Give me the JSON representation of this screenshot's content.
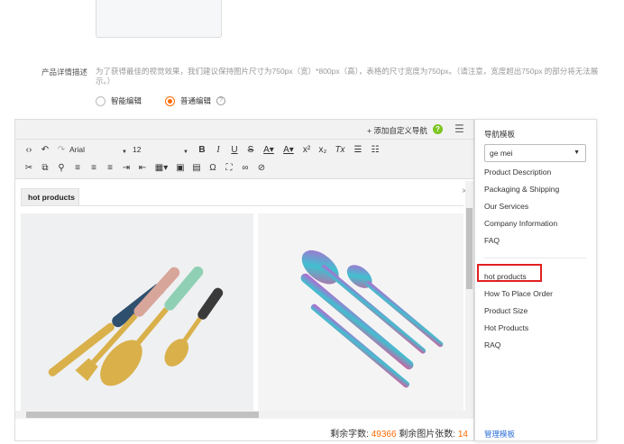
{
  "product_detail": {
    "label": "产品详情描述",
    "hint": "为了获得最佳的视觉效果，我们建议保持图片尺寸为750px（宽）*800px（高），表格的尺寸宽度为750px。（请注意，宽度超出750px 的部分将无法展示。）",
    "mode_smart": "智能编辑",
    "mode_normal": "普通编辑",
    "selected_mode": "普通编辑"
  },
  "editor": {
    "add_nav_label": "+ 添加自定义导航",
    "font_family": "Arial",
    "font_size": "12",
    "tab_label": "hot products",
    "remaining_chars_label": "剩余字数:",
    "remaining_chars_value": "49366",
    "remaining_images_label": "剩余图片张数:",
    "remaining_images_value": "14"
  },
  "sidebar": {
    "title": "导航模板",
    "selected_template": "ge mei",
    "items_top": [
      "Product Description",
      "Packaging & Shipping",
      "Our Services",
      "Company Information",
      "FAQ"
    ],
    "items_bottom": [
      "hot products",
      "How To Place Order",
      "Product Size",
      "Hot Products",
      "RAQ"
    ],
    "highlighted_item": "hot products",
    "manage_label": "管理模板"
  },
  "colors": {
    "accent": "#ff6a00",
    "highlight_border": "#e02020",
    "link": "#2b6fd6",
    "help_green": "#7cc520"
  },
  "icons": {
    "toolbar": [
      "code-icon",
      "undo-icon",
      "redo-icon",
      "bold-icon",
      "italic-icon",
      "underline-icon",
      "strikethrough-icon",
      "font-color-icon",
      "bg-color-icon",
      "superscript-icon",
      "subscript-icon",
      "clear-format-icon",
      "unordered-list-icon",
      "ordered-list-icon",
      "cut-icon",
      "copy-icon",
      "find-icon",
      "align-left-icon",
      "align-center-icon",
      "align-right-icon",
      "indent-icon",
      "outdent-icon",
      "table-icon",
      "image-icon",
      "template-icon",
      "special-char-icon",
      "fullscreen-icon",
      "link-icon",
      "unlink-icon"
    ]
  }
}
